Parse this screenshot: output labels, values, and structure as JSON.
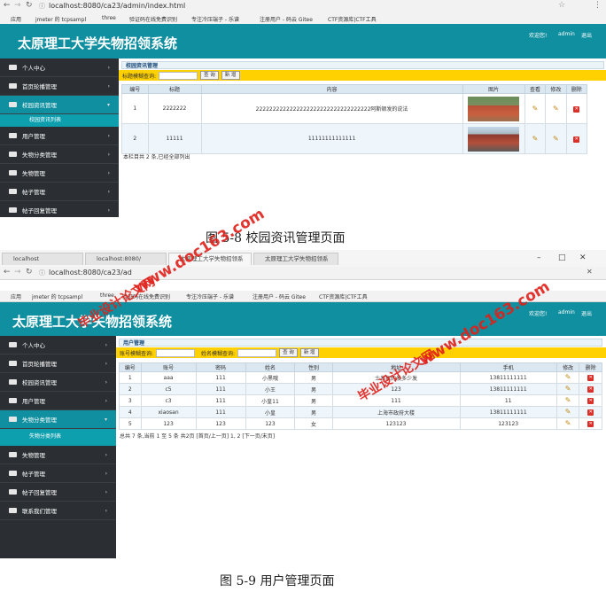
{
  "shot1": {
    "url": "localhost:8080/ca23/admin/index.html",
    "bookmarks": [
      "应用",
      "jmeter 的 tcpsampl",
      "three",
      "验证码在线免费识别",
      "专注冷压端子 - 乐谱",
      "注册用户 - 码云 Gitee",
      "CTF资源库|CTF工具"
    ],
    "app_title": "太原理工大学失物招领系统",
    "header_links": [
      "欢迎您!",
      "admin",
      "退出"
    ],
    "sidebar": [
      {
        "label": "个人中心"
      },
      {
        "label": "首页轮播管理"
      },
      {
        "label": "校园资讯管理",
        "active": true
      },
      {
        "label": "用户管理"
      },
      {
        "label": "失物分类管理"
      },
      {
        "label": "失物管理"
      },
      {
        "label": "帖子管理"
      },
      {
        "label": "帖子回复管理"
      }
    ],
    "sub_item": "校园资讯列表",
    "panel_title": "校园资讯管理",
    "search_label": "标题模糊查询:",
    "search_button": "查 询",
    "add_button": "新 增",
    "columns": [
      "编号",
      "标题",
      "内容",
      "图片",
      "查看",
      "修改",
      "删除"
    ],
    "rows": [
      {
        "id": "1",
        "title": "2222222",
        "content": "2222222222222222222222222222222222阿斯顿发的说法"
      },
      {
        "id": "2",
        "title": "11111",
        "content": "11111111111111"
      }
    ],
    "footer": "本栏目共 2 条,已经全部列出",
    "caption": "图 5-8 校园资讯管理页面"
  },
  "shot2": {
    "tabs": [
      "localhost",
      "localhost:8080/",
      "太原理工大学失物招领系",
      "太原理工大学失物招领系"
    ],
    "url": "localhost:8080/ca23/ad",
    "bookmarks": [
      "应用",
      "jmeter 的 tcpsampl",
      "three",
      "验证码在线免费识别",
      "专注冷压端子 - 乐谱",
      "注册用户 - 码云 Gitee",
      "CTF资源库|CTF工具"
    ],
    "app_title": "太原理工大学失物招领系统",
    "header_links": [
      "欢迎您!",
      "admin",
      "退出"
    ],
    "sidebar": [
      {
        "label": "个人中心"
      },
      {
        "label": "首页轮播管理"
      },
      {
        "label": "校园资讯管理"
      },
      {
        "label": "用户管理"
      },
      {
        "label": "失物分类管理",
        "active": true
      },
      {
        "label": "失物管理"
      },
      {
        "label": "帖子管理"
      },
      {
        "label": "帖子回复管理"
      },
      {
        "label": "联系我们管理"
      }
    ],
    "sub_item": "失物分类列表",
    "panel_title": "用户管理",
    "search_label_1": "账号模糊查询:",
    "search_label_2": "姓名模糊查询:",
    "search_button": "查 询",
    "add_button": "新 增",
    "columns": [
      "编号",
      "账号",
      "密码",
      "姓名",
      "性别",
      "地址",
      "手机",
      "修改",
      "删除"
    ],
    "rows": [
      {
        "id": "1",
        "account": "aaa",
        "password": "111",
        "name": "小黑哦",
        "gender": "男",
        "address": "士发家的发多少发",
        "phone": "13811111111"
      },
      {
        "id": "2",
        "account": "c5",
        "password": "111",
        "name": "小王",
        "gender": "男",
        "address": "123",
        "phone": "13811111111"
      },
      {
        "id": "3",
        "account": "c3",
        "password": "111",
        "name": "小皇11",
        "gender": "男",
        "address": "111",
        "phone": "11"
      },
      {
        "id": "4",
        "account": "xiaosan",
        "password": "111",
        "name": "小皇",
        "gender": "男",
        "address": "上海市政府大楼",
        "phone": "13811111111"
      },
      {
        "id": "5",
        "account": "123",
        "password": "123",
        "name": "123",
        "gender": "女",
        "address": "123123",
        "phone": "123123"
      }
    ],
    "footer": "总共 7 条,当前 1 至 5 条 共2页 [首页/上一页] 1, 2 [下一页/末页]",
    "caption": "图 5-9 用户管理页面"
  },
  "watermarks": [
    "毕业设计论文网",
    "www.doc163.com"
  ],
  "colors": {
    "banner": "#0f8f9f",
    "sidebar": "#2b2f33",
    "search_bar": "#ffd100",
    "watermark": "#e0201a"
  }
}
